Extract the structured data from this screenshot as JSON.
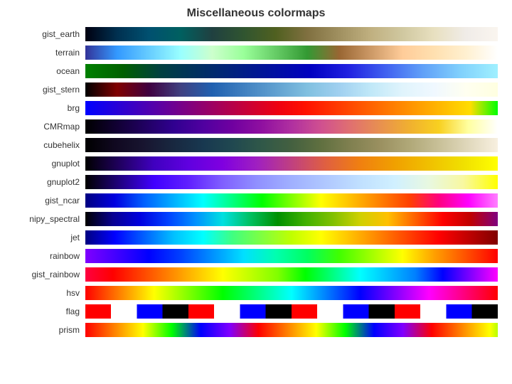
{
  "title": "Miscellaneous colormaps",
  "colormaps": [
    {
      "name": "gist_earth",
      "gradient": "linear-gradient(to right, #000010, #003050, #005070, #006060, #204040, #305530, #506020, #807040, #a09060, #c0b080, #d0c8a0, #e8e0c0, #f0ece8, #faf5ef)"
    },
    {
      "name": "terrain",
      "gradient": "linear-gradient(to right, #333399, #3399ff, #66ccff, #99ffff, #ccffcc, #99ff99, #66cc66, #339933, #996633, #cc9966, #ffcc99, #ffe0b0, #fff0d0, #ffffff)"
    },
    {
      "name": "ocean",
      "gradient": "linear-gradient(to right, #008000, #006000, #004040, #003060, #002080, #0010a0, #0000c0, #2020e0, #4060f0, #60a0f8, #80d0fc, #a0f0ff)"
    },
    {
      "name": "gist_stern",
      "gradient": "linear-gradient(to right, #000000, #800000, #400040, #404080, #2060b0, #4080c0, #60a0d0, #80c0e0, #a0d0f0, #c0e8f8, #e0f4fc, #f0f8ff, #fffff0, #ffffe0)"
    },
    {
      "name": "brg",
      "gradient": "linear-gradient(to right, #0000ff, #2200dd, #4400bb, #660099, #880077, #aa0055, #cc0033, #ee0011, #ff1100, #ff3300, #ff5500, #ff7700, #ff9900, #ffbb00, #ffdd00, #00ff00)"
    },
    {
      "name": "CMRmap",
      "gradient": "linear-gradient(to right, #000000, #100030, #200060, #300090, #5000a0, #7000a0, #9010a0, #b030a0, #d05090, #e07070, #e89050, #f0b030, #f8d020, #ffffa0, #ffffff)"
    },
    {
      "name": "cubehelix",
      "gradient": "linear-gradient(to right, #000000, #100820, #181530, #182840, #183850, #204850, #305848, #446040, #607040, #808050, #9a9060, #b0a878, #c8c098, #e0d8bc, #f8f0e0)"
    },
    {
      "name": "gnuplot",
      "gradient": "linear-gradient(to right, #000000, #200060, #4000c0, #6000e0, #8000e0, #a020c0, #c04080, #e06040, #f08010, #f0a000, #f0c000, #f0e000, #ffff00)"
    },
    {
      "name": "gnuplot2",
      "gradient": "linear-gradient(to right, #000000, #200080, #4000ff, #6020ff, #8060ff, #9090ff, #a0b0ff, #b0c8ff, #c0e0ff, #d0f0ff, #e8f8e0, #f8f8a0, #ffff00)"
    },
    {
      "name": "gist_ncar",
      "gradient": "linear-gradient(to right, #000080, #0000e0, #0060ff, #00b0ff, #00ffff, #00ff80, #00ff00, #80ff00, #ffff00, #ffc000, #ff8000, #ff4000, #ff0080, #ff00ff, #ff80ff)"
    },
    {
      "name": "nipy_spectral",
      "gradient": "linear-gradient(to right, #000000, #080090, #0000e0, #0040ff, #0090ff, #00e0e0, #00c060, #009000, #40b000, #80c000, #d0d000, #ffc000, #ff6000, #ff0000, #c00000, #800080)"
    },
    {
      "name": "jet",
      "gradient": "linear-gradient(to right, #000080, #0000ff, #0060ff, #00c0ff, #00ffff, #40ff80, #80ff40, #c0ff00, #ffff00, #ffc000, #ff8000, #ff4000, #ff0000, #c00000, #800000)"
    },
    {
      "name": "rainbow",
      "gradient": "linear-gradient(to right, #8000ff, #4000ff, #0000ff, #0040ff, #0090ff, #00e0ff, #00ffb0, #00ff60, #40ff00, #a0ff00, #ffff00, #ffa000, #ff5000, #ff0000)"
    },
    {
      "name": "gist_rainbow",
      "gradient": "linear-gradient(to right, #ff0040, #ff0000, #ff4000, #ff8000, #ffc000, #ffff00, #c0ff00, #80ff00, #00ff00, #00ff80, #00ffff, #00c0ff, #0080ff, #0000ff, #8000ff, #ff00ff)"
    },
    {
      "name": "hsv",
      "gradient": "linear-gradient(to right, #ff0000, #ff8000, #ffff00, #80ff00, #00ff00, #00ff80, #00ffff, #0080ff, #0000ff, #8000ff, #ff00ff, #ff0080, #ff0000)"
    },
    {
      "name": "flag",
      "gradient": "repeating-linear-gradient(to right, #ff0000 0%, #ff0000 6.25%, #ffffff 6.25%, #ffffff 12.5%, #0000ff 12.5%, #0000ff 18.75%, #000000 18.75%, #000000 25%)"
    },
    {
      "name": "prism",
      "gradient": "repeating-linear-gradient(to right, #ff0000 0%, #ff8000 7%, #ffff00 14%, #00ff00 21%, #0000ff 28%, #8000ff 35%, #ff0000 42%)"
    }
  ]
}
